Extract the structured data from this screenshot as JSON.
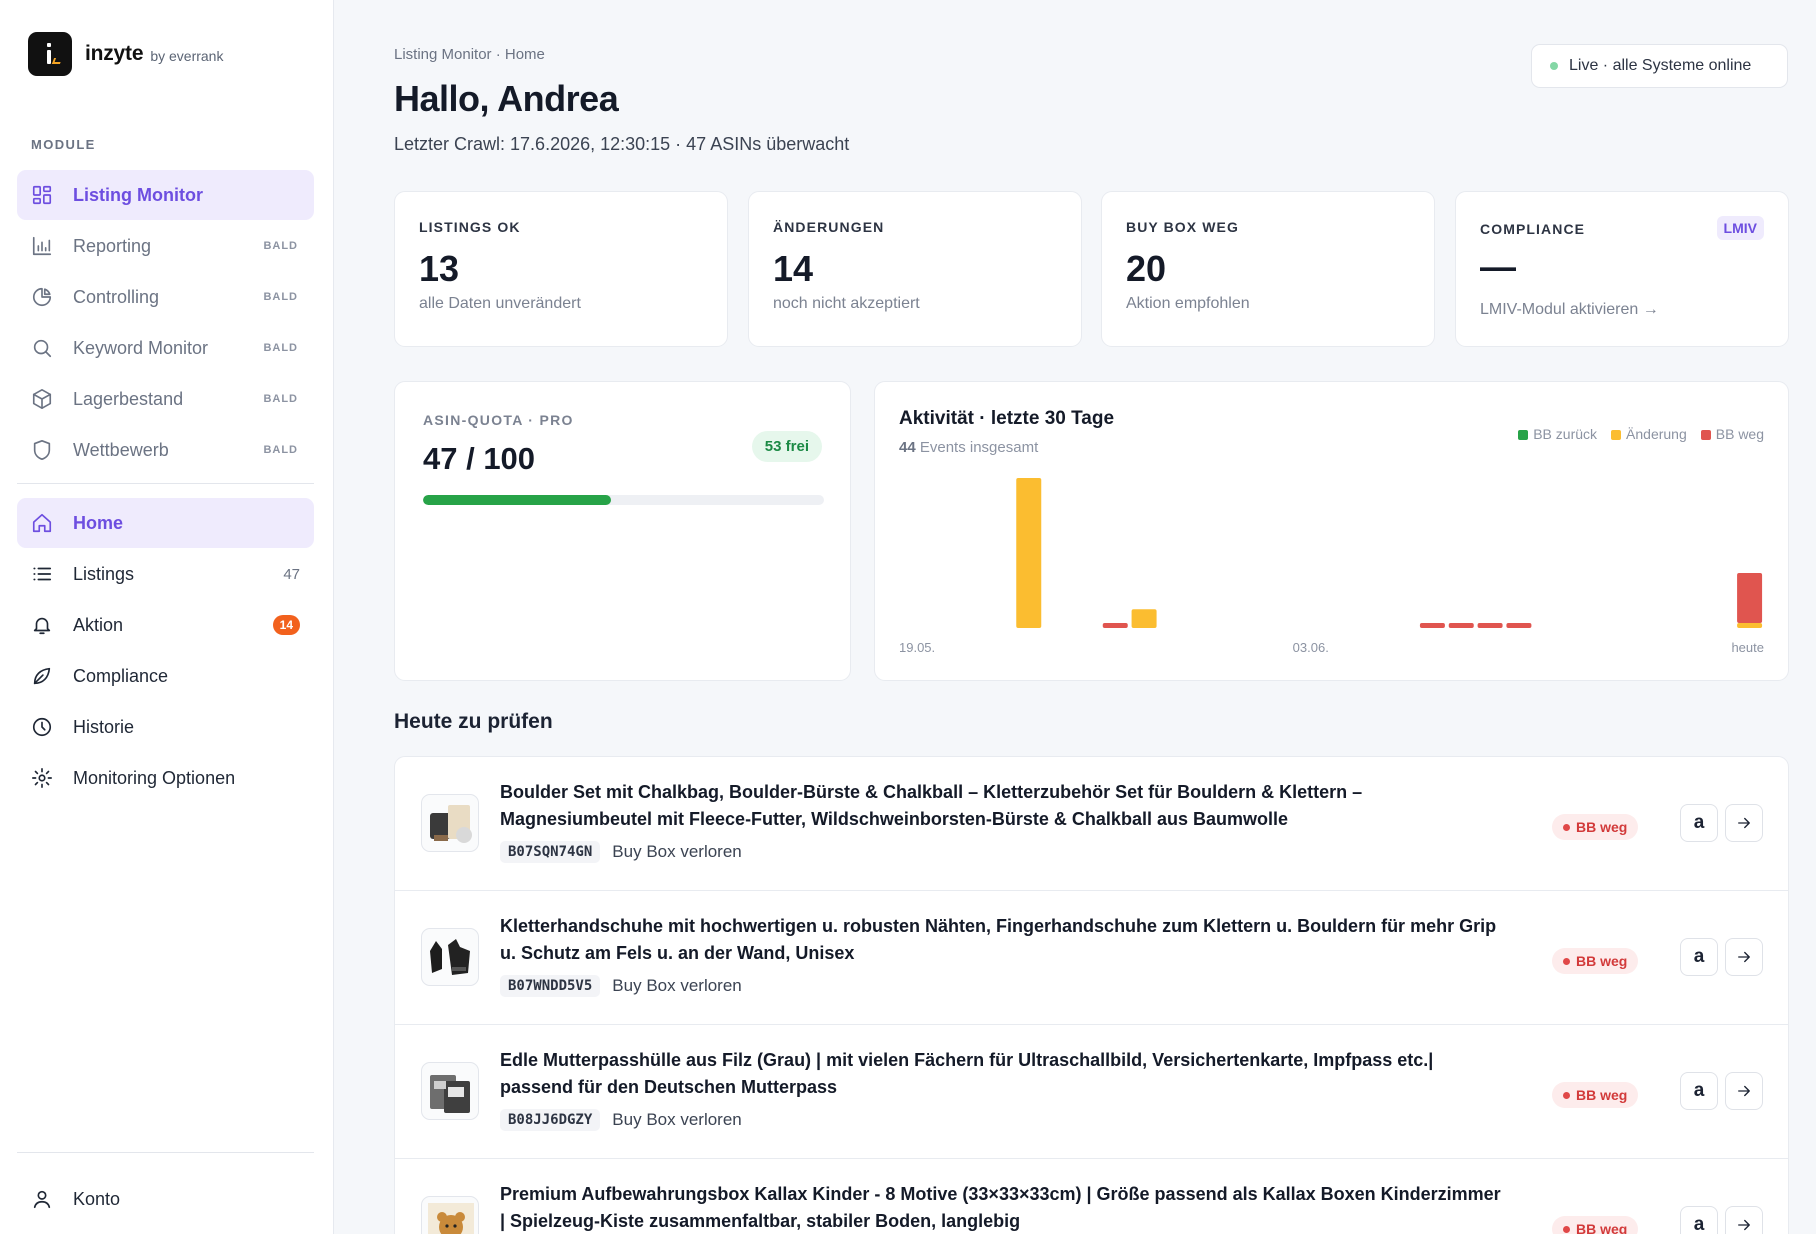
{
  "brand": {
    "name": "inzyte",
    "by": "by everrank"
  },
  "sidebar": {
    "section_title": "MODULE",
    "modules": [
      {
        "label": "Listing Monitor",
        "icon": "grid-icon",
        "active": true
      },
      {
        "label": "Reporting",
        "icon": "bar-chart-icon",
        "tag": "BALD"
      },
      {
        "label": "Controlling",
        "icon": "pie-chart-icon",
        "tag": "BALD"
      },
      {
        "label": "Keyword Monitor",
        "icon": "search-icon",
        "tag": "BALD"
      },
      {
        "label": "Lagerbestand",
        "icon": "box-icon",
        "tag": "BALD"
      },
      {
        "label": "Wettbewerb",
        "icon": "shield-icon",
        "tag": "BALD"
      }
    ],
    "nav": [
      {
        "label": "Home",
        "icon": "home-icon",
        "active": true
      },
      {
        "label": "Listings",
        "icon": "list-icon",
        "count": "47"
      },
      {
        "label": "Aktion",
        "icon": "bell-icon",
        "badge": "14"
      },
      {
        "label": "Compliance",
        "icon": "leaf-icon"
      },
      {
        "label": "Historie",
        "icon": "clock-icon"
      },
      {
        "label": "Monitoring Optionen",
        "icon": "gear-icon"
      }
    ],
    "account": {
      "label": "Konto",
      "icon": "user-icon"
    }
  },
  "header": {
    "breadcrumb": "Listing Monitor · Home",
    "greeting": "Hallo, Andrea",
    "subline": "Letzter Crawl: 17.6.2026, 12:30:15 · 47 ASINs überwacht",
    "live_status": "Live · alle Systeme online"
  },
  "stats": [
    {
      "label": "LISTINGS OK",
      "value": "13",
      "sub": "alle Daten unverändert"
    },
    {
      "label": "ÄNDERUNGEN",
      "value": "14",
      "sub": "noch nicht akzeptiert"
    },
    {
      "label": "BUY BOX WEG",
      "value": "20",
      "sub": "Aktion empfohlen"
    },
    {
      "label": "COMPLIANCE",
      "value": "—",
      "sub": "LMIV-Modul aktivieren →",
      "tag": "LMIV"
    }
  ],
  "quota": {
    "label": "ASIN-QUOTA · PRO",
    "value": "47 / 100",
    "free": "53 frei",
    "used": 47,
    "total": 100
  },
  "activity": {
    "title": "Aktivität · letzte 30 Tage",
    "count": "44",
    "count_suffix": "Events insgesamt",
    "legend": [
      {
        "name": "BB zurück",
        "color": "#27a348"
      },
      {
        "name": "Änderung",
        "color": "#fbbd30"
      },
      {
        "name": "BB weg",
        "color": "#e0554f"
      }
    ]
  },
  "chart_data": {
    "type": "bar",
    "stacked": true,
    "x_tick_labels": [
      "19.05.",
      "03.06.",
      "heute"
    ],
    "days": 30,
    "series": [
      {
        "name": "BB zurück",
        "color": "#27a348",
        "values": [
          0,
          0,
          0,
          0,
          0,
          0,
          0,
          0,
          0,
          0,
          0,
          0,
          0,
          0,
          0,
          0,
          0,
          0,
          0,
          0,
          0,
          0,
          0,
          0,
          0,
          0,
          0,
          0,
          0,
          0
        ]
      },
      {
        "name": "Änderung",
        "color": "#fbbd30",
        "values": [
          0,
          0,
          0,
          0,
          12,
          0,
          0,
          0,
          1.5,
          0,
          0,
          0,
          0,
          0,
          0,
          0,
          0,
          0,
          0,
          0,
          0,
          0,
          0,
          0,
          0,
          0,
          0,
          0,
          0,
          0.4
        ]
      },
      {
        "name": "BB weg",
        "color": "#e0554f",
        "values": [
          0,
          0,
          0,
          0,
          0,
          0,
          0,
          0.4,
          0,
          0,
          0,
          0,
          0,
          0,
          0,
          0,
          0,
          0,
          0.4,
          0.4,
          0.4,
          0.4,
          0,
          0,
          0,
          0,
          0,
          0,
          0,
          4
        ]
      }
    ]
  },
  "todo": {
    "title": "Heute zu prüfen",
    "items": [
      {
        "title": "Boulder Set mit Chalkbag, Boulder-Bürste & Chalkball – Kletterzubehör Set für Bouldern & Klettern – Magnesiumbeutel mit Fleece-Futter, Wildschweinborsten-Bürste & Chalkball aus Baumwolle",
        "asin": "B07SQN74GN",
        "reason": "Buy Box verloren",
        "status": "BB weg"
      },
      {
        "title": " Kletterhandschuhe mit hochwertigen u. robusten Nähten, Fingerhandschuhe zum Klettern u. Bouldern für mehr Grip u. Schutz am Fels u. an der Wand, Unisex",
        "asin": "B07WNDD5V5",
        "reason": "Buy Box verloren",
        "status": "BB weg"
      },
      {
        "title": "Edle Mutterpasshülle aus Filz (Grau) | mit vielen Fächern für Ultraschallbild, Versichertenkarte, Impfpass etc.| passend für den Deutschen Mutterpass",
        "asin": "B08JJ6DGZY",
        "reason": "Buy Box verloren",
        "status": "BB weg"
      },
      {
        "title": "Premium Aufbewahrungsbox Kallax Kinder - 8 Motive (33×33×33cm) | Größe passend als Kallax Boxen Kinderzimmer | Spielzeug-Kiste zusammenfaltbar, stabiler Boden, langlebig",
        "asin": "",
        "reason": "",
        "status": "BB weg"
      }
    ],
    "amazon_button": "a"
  }
}
